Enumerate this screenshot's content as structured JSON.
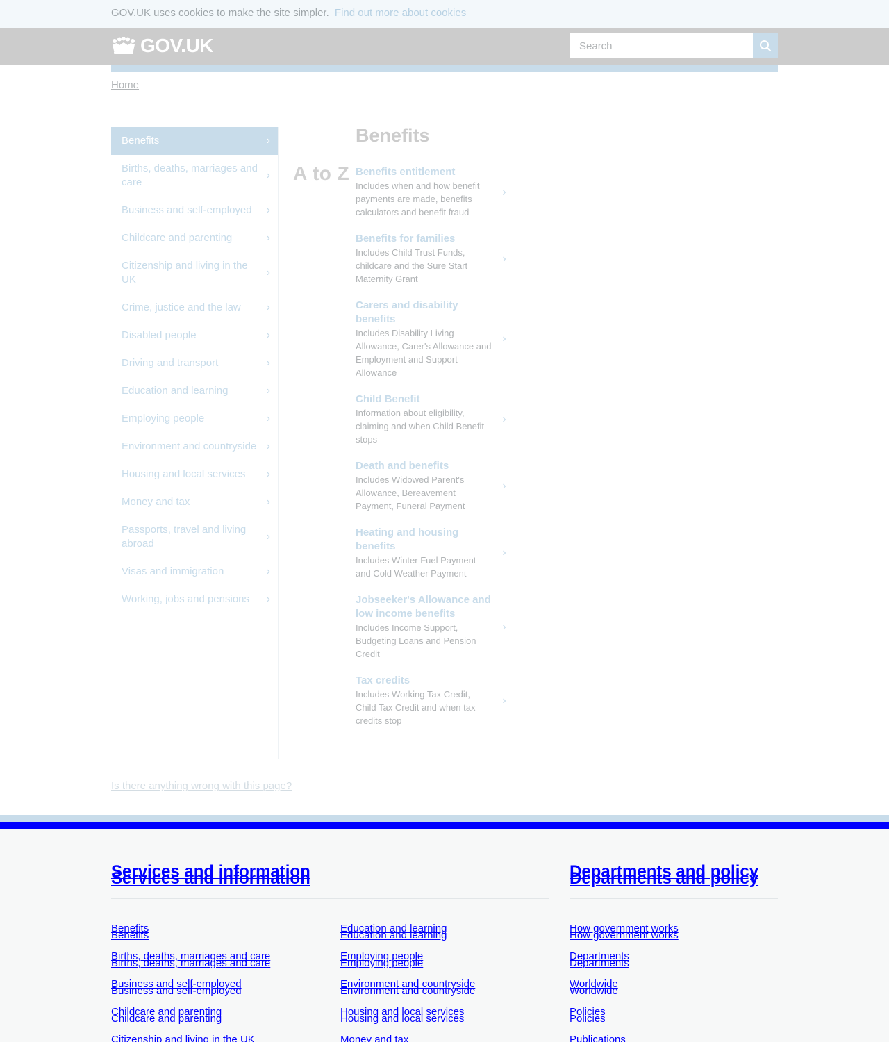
{
  "cookie": {
    "text": "GOV.UK uses cookies to make the site simpler.",
    "link": "Find out more about cookies"
  },
  "header": {
    "logo": "GOV.UK",
    "search_placeholder": "Search"
  },
  "breadcrumb": {
    "home": "Home"
  },
  "nav": {
    "items": [
      "Benefits",
      "Births, deaths, marriages and care",
      "Business and self-employed",
      "Childcare and parenting",
      "Citizenship and living in the UK",
      "Crime, justice and the law",
      "Disabled people",
      "Driving and transport",
      "Education and learning",
      "Employing people",
      "Environment and countryside",
      "Housing and local services",
      "Money and tax",
      "Passports, travel and living abroad",
      "Visas and immigration",
      "Working, jobs and pensions"
    ],
    "active": "Benefits",
    "chevron": "›"
  },
  "atoz": "A to Z",
  "main": {
    "title": "Benefits",
    "topics": [
      {
        "title": "Benefits entitlement",
        "desc": "Includes when and how benefit payments are made, benefits calculators and benefit fraud"
      },
      {
        "title": "Benefits for families",
        "desc": "Includes Child Trust Funds, childcare and the Sure Start Maternity Grant"
      },
      {
        "title": "Carers and disability benefits",
        "desc": "Includes Disability Living Allowance, Carer's Allowance and Employment and Support Allowance"
      },
      {
        "title": "Child Benefit",
        "desc": "Information about eligibility, claiming and when Child Benefit stops"
      },
      {
        "title": "Death and benefits",
        "desc": "Includes Widowed Parent's Allowance, Bereavement Payment, Funeral Payment"
      },
      {
        "title": "Heating and housing benefits",
        "desc": "Includes Winter Fuel Payment and Cold Weather Payment"
      },
      {
        "title": "Jobseeker's Allowance and low income benefits",
        "desc": "Includes Income Support, Budgeting Loans and Pension Credit"
      },
      {
        "title": "Tax credits",
        "desc": "Includes Working Tax Credit, Child Tax Credit and when tax credits stop"
      }
    ]
  },
  "report_link": "Is there anything wrong with this page?",
  "footer": {
    "services_title": "Services and information",
    "departments_title": "Departments and policy",
    "services_col1": [
      "Benefits",
      "Births, deaths, marriages and care",
      "Business and self-employed",
      "Childcare and parenting",
      "Citizenship and living in the UK"
    ],
    "services_col2": [
      "Education and learning",
      "Employing people",
      "Environment and countryside",
      "Housing and local services",
      "Money and tax"
    ],
    "departments": [
      "How government works",
      "Departments",
      "Worldwide",
      "Policies",
      "Publications"
    ]
  },
  "colors": {
    "accent": "#c8dcea",
    "footer_link": "#0000ff",
    "header_bg": "#cccccc"
  }
}
